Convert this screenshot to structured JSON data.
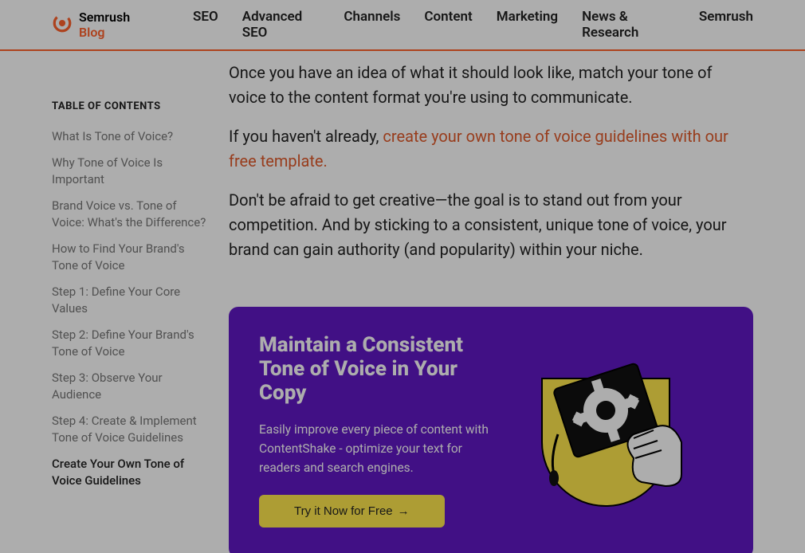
{
  "header": {
    "brand_main": "Semrush",
    "brand_accent": "Blog",
    "nav": [
      "SEO",
      "Advanced SEO",
      "Channels",
      "Content",
      "Marketing",
      "News & Research",
      "Semrush"
    ]
  },
  "toc": {
    "title": "TABLE OF CONTENTS",
    "items": [
      {
        "label": "What Is Tone of Voice?",
        "active": false
      },
      {
        "label": "Why Tone of Voice Is Important",
        "active": false
      },
      {
        "label": "Brand Voice vs. Tone of Voice: What's the Difference?",
        "active": false
      },
      {
        "label": "How to Find Your Brand's Tone of Voice",
        "active": false
      },
      {
        "label": "Step 1: Define Your Core Values",
        "active": false
      },
      {
        "label": "Step 2: Define Your Brand's Tone of Voice",
        "active": false
      },
      {
        "label": "Step 3: Observe Your Audience",
        "active": false
      },
      {
        "label": "Step 4: Create & Implement Tone of Voice Guidelines",
        "active": false
      },
      {
        "label": "Create Your Own Tone of Voice Guidelines",
        "active": true
      }
    ]
  },
  "article": {
    "p1": "Once you have an idea of what it should look like, match your tone of voice to the content format you're using to communicate.",
    "p2_pre": "If you haven't already, ",
    "p2_link": "create your own tone of voice guidelines with our free template.",
    "p3": "Don't be afraid to get creative—the goal is to stand out from your competition. And by sticking to a consistent, unique tone of voice, your brand can gain authority (and popularity) within your niche."
  },
  "promo": {
    "title": "Maintain a Consistent Tone of Voice in Your Copy",
    "body": "Easily improve every piece of content with ContentShake - optimize your text for readers and search engines.",
    "button": "Try it Now for Free",
    "button_arrow": "→"
  },
  "colors": {
    "accent": "#ff622d",
    "promo_bg": "#6019c4",
    "promo_btn": "#ffe84d"
  }
}
